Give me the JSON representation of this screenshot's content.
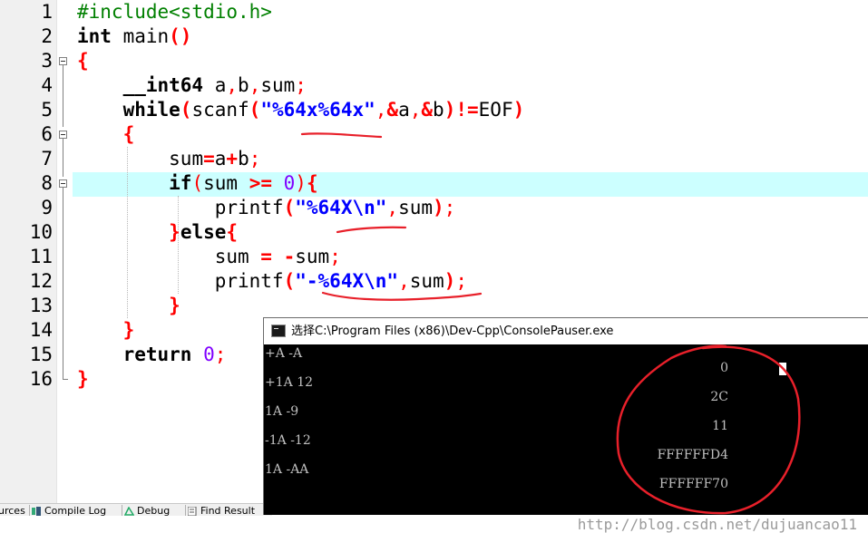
{
  "editor": {
    "line_numbers": [
      "1",
      "2",
      "3",
      "4",
      "5",
      "6",
      "7",
      "8",
      "9",
      "10",
      "11",
      "12",
      "13",
      "14",
      "15",
      "16"
    ],
    "current_line": "8"
  },
  "code": {
    "l1": {
      "directive": "#include<stdio.h>"
    },
    "l2": {
      "type": "int",
      "name": " main",
      "parens": "()"
    },
    "l3": {
      "brace": "{"
    },
    "l4": {
      "type": "__int64",
      "vars_a": " a",
      "c1": ",",
      "vars_b": "b",
      "c2": ",",
      "vars_sum": "sum",
      "semi": ";"
    },
    "l5": {
      "kw": "while",
      "p1": "(",
      "fn": "scanf",
      "p2": "(",
      "fmt": "\"%64x%64x\"",
      "c1": ",",
      "amp1": "&",
      "a": "a",
      "c2": ",",
      "amp2": "&",
      "b": "b",
      "p3": ")",
      "neq": "!=",
      "eof": "EOF",
      "p4": ")"
    },
    "l6": {
      "brace": "{"
    },
    "l7": {
      "lhs": "sum",
      "eq": "=",
      "a": "a",
      "plus": "+",
      "b": "b",
      "semi": ";"
    },
    "l8": {
      "kw": "if",
      "p1": "(",
      "var": "sum ",
      "op": ">=",
      "sp": " ",
      "zero": "0",
      "p2": ")",
      "brace": "{"
    },
    "l9": {
      "fn": "printf",
      "p1": "(",
      "q1": "\"",
      "fmt": "%64X",
      "esc": "\\n",
      "q2": "\"",
      "c": ",",
      "arg": "sum",
      "p2": ")",
      "semi": ";"
    },
    "l10": {
      "brace1": "}",
      "kw": "else",
      "brace2": "{"
    },
    "l11": {
      "lhs": "sum ",
      "eq": "=",
      "sp": " ",
      "neg": "-",
      "rhs": "sum",
      "semi": ";"
    },
    "l12": {
      "fn": "printf",
      "p1": "(",
      "q1": "\"",
      "fmt": "-%64X",
      "esc": "\\n",
      "q2": "\"",
      "c": ",",
      "arg": "sum",
      "p2": ")",
      "semi": ";"
    },
    "l13": {
      "brace": "}"
    },
    "l14": {
      "brace": "}"
    },
    "l15": {
      "kw": "return",
      "sp": " ",
      "zero": "0",
      "semi": ";"
    },
    "l16": {
      "brace": "}"
    }
  },
  "bottom_tabs": [
    {
      "label": "urces",
      "icon": "resources-icon"
    },
    {
      "label": "Compile Log",
      "icon": "compile-log-icon"
    },
    {
      "label": "Debug",
      "icon": "debug-icon"
    },
    {
      "label": "Find Result",
      "icon": "find-results-icon"
    }
  ],
  "console": {
    "title": "选择C:\\Program Files (x86)\\Dev-Cpp\\ConsolePauser.exe",
    "inputs": [
      "+A -A",
      "+1A 12",
      "1A -9",
      "-1A -12",
      "1A -AA"
    ],
    "outputs": [
      "0",
      "2C",
      "11",
      "FFFFFFD4",
      "FFFFFF70"
    ],
    "watermark": "http://blog.csdn.net/dujuancao11"
  },
  "colors": {
    "current_line_bg": "#ccffff",
    "annotation_red": "#e8202a",
    "preprocessor": "#008000",
    "string": "#0000ff",
    "symbol": "#ff0000",
    "number": "#8000ff"
  }
}
